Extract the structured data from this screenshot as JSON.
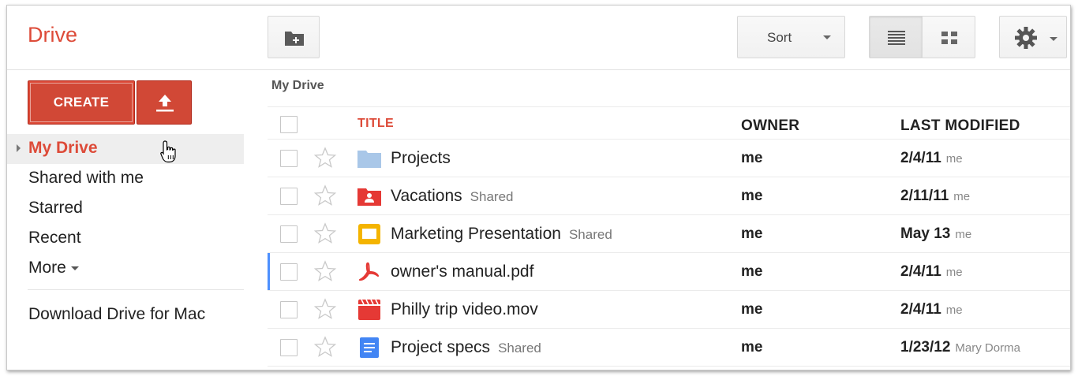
{
  "app": {
    "title": "Drive"
  },
  "toolbar": {
    "new_folder_icon": "folder-plus-icon",
    "sort_label": "Sort",
    "list_view_icon": "list-view-icon",
    "grid_view_icon": "grid-view-icon",
    "settings_icon": "gear-icon"
  },
  "sidebar": {
    "create_label": "CREATE",
    "upload_icon": "upload-icon",
    "items": [
      {
        "label": "My Drive"
      },
      {
        "label": "Shared with me"
      },
      {
        "label": "Starred"
      },
      {
        "label": "Recent"
      },
      {
        "label": "More"
      }
    ],
    "download_label": "Download Drive for Mac"
  },
  "main": {
    "breadcrumb": "My Drive",
    "columns": {
      "title": "TITLE",
      "owner": "OWNER",
      "modified": "LAST MODIFIED"
    },
    "files": [
      {
        "name": "Projects",
        "shared": "",
        "owner": "me",
        "date": "2/4/11",
        "by": "me",
        "icon": "folder-icon"
      },
      {
        "name": "Vacations",
        "shared": "Shared",
        "owner": "me",
        "date": "2/11/11",
        "by": "me",
        "icon": "shared-folder-icon"
      },
      {
        "name": "Marketing Presentation",
        "shared": "Shared",
        "owner": "me",
        "date": "May 13",
        "by": "me",
        "icon": "presentation-icon"
      },
      {
        "name": "owner's manual.pdf",
        "shared": "",
        "owner": "me",
        "date": "2/4/11",
        "by": "me",
        "icon": "pdf-icon"
      },
      {
        "name": "Philly trip video.mov",
        "shared": "",
        "owner": "me",
        "date": "2/4/11",
        "by": "me",
        "icon": "video-icon"
      },
      {
        "name": "Project specs",
        "shared": "Shared",
        "owner": "me",
        "date": "1/23/12",
        "by": "Mary Dorma",
        "icon": "document-icon"
      }
    ]
  },
  "colors": {
    "accent": "#dd4b39",
    "focus": "#4d90fe"
  }
}
